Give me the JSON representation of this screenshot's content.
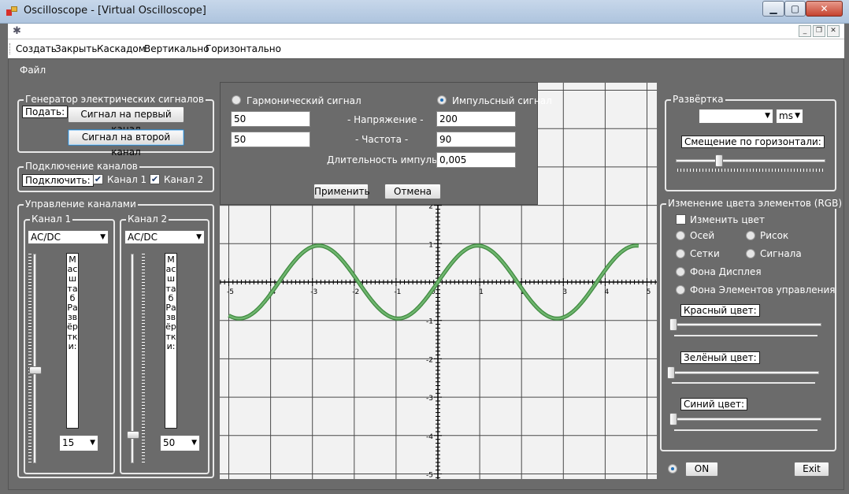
{
  "window": {
    "title": "Oscilloscope - [Virtual Oscilloscope]"
  },
  "menubar": {
    "items": [
      "Создать",
      "Закрыть",
      "Каскадом",
      "Вертикально",
      "Горизонтально"
    ]
  },
  "file_menu": "Файл",
  "generator": {
    "title": "Генератор электрических сигналов",
    "feed_label": "Подать:",
    "btn_ch1": "Сигнал на первый канал",
    "btn_ch2": "Сигнал на второй канал"
  },
  "connect": {
    "title": "Подключение каналов",
    "label": "Подключить:",
    "ch1": {
      "label": "Канал 1",
      "checked": true
    },
    "ch2": {
      "label": "Канал 2",
      "checked": true
    }
  },
  "channels": {
    "title": "Управление каналами",
    "ch1": {
      "title": "Канал 1",
      "coupling": "AC/DC",
      "scale_label": "Масштаб Развёртки:",
      "scale_value": "15",
      "position_level": 0.44
    },
    "ch2": {
      "title": "Канал 2",
      "coupling": "AC/DC",
      "scale_label": "Масштаб Развёртки:",
      "scale_value": "50",
      "position_level": 0.12
    }
  },
  "signal_panel": {
    "harmonic_label": "Гармонический сигнал",
    "pulse_label": "Импульсный сигнал",
    "selected": "pulse",
    "voltage_label": "- Напряжение -",
    "freq_label": "- Частота -",
    "pulse_width_label": "Длительность импульса -",
    "harmonic_voltage": "50",
    "harmonic_freq": "50",
    "pulse_voltage": "200",
    "pulse_freq": "90",
    "pulse_width": "0,005",
    "apply": "Применить",
    "cancel": "Отмена"
  },
  "sweep": {
    "title": "Развёртка",
    "value": "",
    "unit": "ms",
    "offset_label": "Смещение по горизонтали:",
    "offset_level": 0.28
  },
  "color": {
    "title": "Изменение цвета элементов (RGB)",
    "change_label": "Изменить цвет",
    "change_checked": false,
    "options": [
      "Осей",
      "Рисок",
      "Сетки",
      "Сигнала",
      "Фона Дисплея",
      "Фона Элементов управления"
    ],
    "red_label": "Красный цвет:",
    "green_label": "Зелёный цвет:",
    "blue_label": "Синий цвет:",
    "red_level": 0.0,
    "green_level": 0.0,
    "blue_level": 0.0
  },
  "bottom": {
    "on_label": "ON",
    "on_selected": true,
    "exit_label": "Exit"
  },
  "colors": {
    "background": "#6b6b6b",
    "grid": "#4a4a4a",
    "signal": "#6fb56f",
    "signal_edge": "#3f8a3f",
    "display": "#f2f2f2"
  },
  "chart_data": {
    "type": "line",
    "x_ticks": [
      "-5",
      "-4",
      "-3",
      "-2",
      "-1",
      "0",
      "1",
      "2",
      "3",
      "4",
      "5"
    ],
    "y_ticks": [
      "2",
      "1",
      "0",
      "-1",
      "-2",
      "-3",
      "-4",
      "-5"
    ],
    "xlim": [
      -5,
      5
    ],
    "ylim": [
      -5,
      3
    ],
    "series": [
      {
        "type": "sine",
        "amplitude": 0.95,
        "period": 3.8,
        "phase": 0,
        "x_range": [
          -5,
          4.8
        ]
      }
    ]
  }
}
